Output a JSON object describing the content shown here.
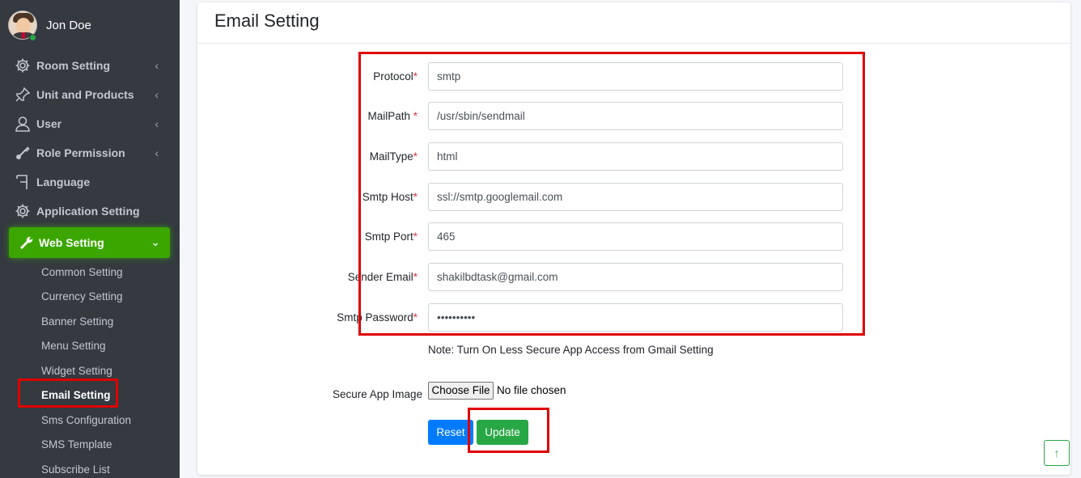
{
  "user": {
    "name": "Jon Doe"
  },
  "sidebar": {
    "items": [
      {
        "label": "Room Setting",
        "icon": "gear-icon",
        "has_chevron": true
      },
      {
        "label": "Unit and Products",
        "icon": "pin-icon",
        "has_chevron": true
      },
      {
        "label": "User",
        "icon": "user-icon",
        "has_chevron": true
      },
      {
        "label": "Role Permission",
        "icon": "key-icon",
        "has_chevron": true
      },
      {
        "label": "Language",
        "icon": "flag-icon",
        "has_chevron": false
      },
      {
        "label": "Application Setting",
        "icon": "gear-icon",
        "has_chevron": true
      },
      {
        "label": "Web Setting",
        "icon": "wrench-icon",
        "has_chevron": true,
        "active": true
      }
    ],
    "web_setting_sub": [
      "Common Setting",
      "Currency Setting",
      "Banner Setting",
      "Menu Setting",
      "Widget Setting",
      "Email Setting",
      "Sms Configuration",
      "SMS Template",
      "Subscribe List"
    ],
    "current_sub": "Email Setting",
    "chevron_left": "‹",
    "chevron_down": "⌄"
  },
  "page": {
    "title": "Email Setting"
  },
  "form": {
    "required_mark": "*",
    "fields": [
      {
        "label": "Protocol",
        "value": "smtp"
      },
      {
        "label": "MailPath ",
        "value": "/usr/sbin/sendmail"
      },
      {
        "label": "MailType",
        "value": "html"
      },
      {
        "label": "Smtp Host",
        "value": "ssl://smtp.googlemail.com"
      },
      {
        "label": "Smtp Port",
        "value": "465"
      },
      {
        "label": "Sender Email",
        "value": "shakilbdtask@gmail.com"
      },
      {
        "label": "Smtp Password",
        "value": "••••••••••"
      }
    ],
    "note": "Note: Turn On Less Secure App Access from Gmail Setting",
    "file": {
      "label": "Secure App Image",
      "button": "Choose File",
      "status": "No file chosen"
    },
    "reset_label": "Reset",
    "update_label": "Update"
  },
  "scroll_top": {
    "icon": "arrow-up-icon",
    "glyph": "↑"
  },
  "colors": {
    "sidebar_bg": "#343a40",
    "active_green": "#3ca600",
    "highlight_red": "#e00000",
    "reset_blue": "#007bff",
    "update_green": "#28a745"
  }
}
